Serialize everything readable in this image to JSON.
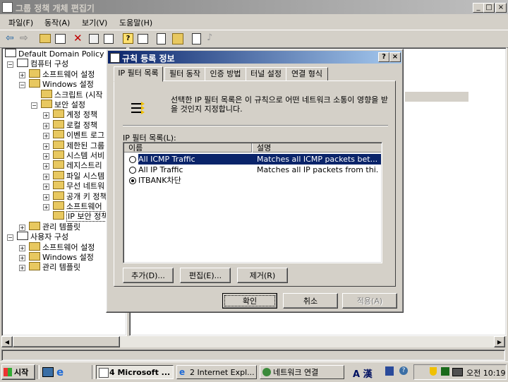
{
  "main_window": {
    "title": "그룹 정책 개체 편집기",
    "menu": [
      "파일(F)",
      "동작(A)",
      "보기(V)",
      "도움말(H)"
    ],
    "tree": [
      {
        "label": "Default Domain Policy [I",
        "depth": 0
      },
      {
        "label": "컴퓨터 구성",
        "depth": 1
      },
      {
        "label": "소프트웨어 설정",
        "depth": 2
      },
      {
        "label": "Windows 설정",
        "depth": 2
      },
      {
        "label": "스크립트 (시작",
        "depth": 3
      },
      {
        "label": "보안 설정",
        "depth": 3
      },
      {
        "label": "계정 정책",
        "depth": 4
      },
      {
        "label": "로컬 정책",
        "depth": 4
      },
      {
        "label": "이벤트 로그",
        "depth": 4
      },
      {
        "label": "제한된 그룹",
        "depth": 4
      },
      {
        "label": "시스템 서비",
        "depth": 4
      },
      {
        "label": "레지스트리",
        "depth": 4
      },
      {
        "label": "파일 시스템",
        "depth": 4
      },
      {
        "label": "무선 네트워",
        "depth": 4
      },
      {
        "label": "공개 키 정책",
        "depth": 4
      },
      {
        "label": "소프트웨어",
        "depth": 4
      },
      {
        "label": "IP 보안 정책",
        "depth": 4
      },
      {
        "label": "관리 템플릿",
        "depth": 2
      },
      {
        "label": "사용자 구성",
        "depth": 1
      },
      {
        "label": "소프트웨어 설정",
        "depth": 2
      },
      {
        "label": "Windows 설정",
        "depth": 2
      },
      {
        "label": "관리 템플릿",
        "depth": 2
      }
    ]
  },
  "dialog": {
    "title": "규칙 등록 정보",
    "help_btn": "?",
    "close_btn": "×",
    "tabs": [
      "IP 필터 목록",
      "필터 동작",
      "인증 방법",
      "터널 설정",
      "연결 형식"
    ],
    "description": "선택한 IP 필터 목록은 이 규칙으로 어떤 네트워크 소통이 영향을 받을 것인지 지정합니다.",
    "list_label": "IP 필터 목록(L):",
    "columns": [
      "이름",
      "설명"
    ],
    "rows": [
      {
        "name": "All ICMP Traffic",
        "desc": "Matches all ICMP packets bet...",
        "selected": true,
        "checked": false
      },
      {
        "name": "All IP Traffic",
        "desc": "Matches all IP packets from thi...",
        "selected": false,
        "checked": false
      },
      {
        "name": "ITBANK차단",
        "desc": "",
        "selected": false,
        "checked": true
      }
    ],
    "buttons": {
      "add": "추가(D)...",
      "edit": "편집(E)...",
      "remove": "제거(R)"
    },
    "footer": {
      "ok": "확인",
      "cancel": "취소",
      "apply": "적용(A)"
    }
  },
  "taskbar": {
    "start": "시작",
    "tasks": [
      "4 Microsoft ...",
      "2 Internet Expl...",
      "네트워크 연결"
    ],
    "tray_lang": "A 漢",
    "clock": "오전 10:19"
  },
  "colors": {
    "accent": "#0a246a",
    "desktop_bg": "#d4d0c8",
    "selection": "#0a246a"
  }
}
